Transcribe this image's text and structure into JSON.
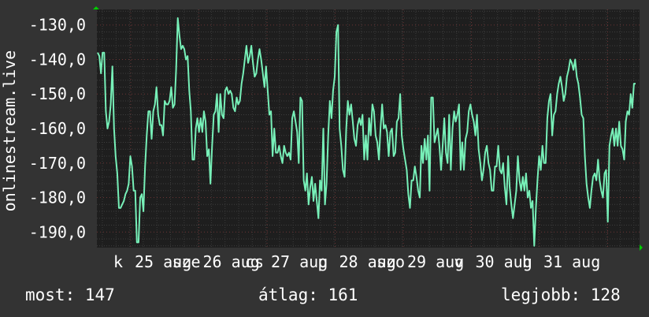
{
  "chart_data": {
    "type": "line",
    "ylabel": "onlinestream.live",
    "ylim": [
      -194.5,
      -125.5
    ],
    "yticks": [
      "-130,0",
      "-140,0",
      "-150,0",
      "-160,0",
      "-170,0",
      "-180,0",
      "-190,0"
    ],
    "ytick_values": [
      -130,
      -140,
      -150,
      -160,
      -170,
      -180,
      -190
    ],
    "xticks": [
      "k",
      "25 aug",
      "sze",
      "26 aug",
      "cs",
      "27 aug",
      "p",
      "28 aug",
      "szo",
      "29 aug",
      "v",
      "30 aug",
      "h",
      "31 aug"
    ],
    "grid": true,
    "series_color": "#77f0b8",
    "background": "#1e1e1e",
    "series": [
      {
        "values": [
          -138,
          -139,
          -144,
          -138,
          -138,
          -155,
          -160,
          -158,
          -153,
          -142,
          -160,
          -168,
          -173,
          -183,
          -183,
          -182,
          -181,
          -179,
          -178,
          -176,
          -168,
          -171,
          -178,
          -178,
          -193,
          -193,
          -180,
          -179,
          -184,
          -171,
          -162,
          -155,
          -155,
          -163,
          -155,
          -153,
          -148,
          -156,
          -159,
          -159,
          -162,
          -152,
          -153,
          -153,
          -152,
          -148,
          -154,
          -153,
          -143,
          -128,
          -133,
          -137,
          -136,
          -137,
          -140,
          -139,
          -149,
          -155,
          -169,
          -169,
          -160,
          -157,
          -161,
          -157,
          -161,
          -155,
          -158,
          -168,
          -166,
          -176,
          -165,
          -156,
          -155,
          -150,
          -161,
          -150,
          -156,
          -157,
          -149,
          -148,
          -150,
          -149,
          -150,
          -154,
          -155,
          -151,
          -153,
          -152,
          -147,
          -144,
          -140,
          -136,
          -141,
          -139,
          -136,
          -141,
          -145,
          -144,
          -140,
          -137,
          -140,
          -144,
          -148,
          -142,
          -149,
          -156,
          -155,
          -168,
          -160,
          -167,
          -167,
          -165,
          -168,
          -170,
          -165,
          -167,
          -168,
          -167,
          -169,
          -157,
          -155,
          -158,
          -161,
          -170,
          -151,
          -152,
          -175,
          -178,
          -173,
          -182,
          -177,
          -174,
          -181,
          -176,
          -181,
          -186,
          -175,
          -178,
          -160,
          -182,
          -176,
          -162,
          -152,
          -157,
          -149,
          -145,
          -132,
          -130,
          -160,
          -165,
          -172,
          -174,
          -160,
          -152,
          -156,
          -153,
          -158,
          -163,
          -165,
          -159,
          -157,
          -159,
          -156,
          -169,
          -162,
          -169,
          -157,
          -162,
          -153,
          -155,
          -162,
          -164,
          -169,
          -160,
          -153,
          -160,
          -159,
          -161,
          -168,
          -161,
          -160,
          -168,
          -167,
          -158,
          -157,
          -150,
          -162,
          -166,
          -169,
          -172,
          -179,
          -183,
          -175,
          -175,
          -171,
          -174,
          -178,
          -180,
          -165,
          -170,
          -163,
          -169,
          -162,
          -178,
          -151,
          -151,
          -164,
          -162,
          -160,
          -165,
          -172,
          -165,
          -157,
          -167,
          -170,
          -156,
          -172,
          -160,
          -155,
          -158,
          -156,
          -153,
          -172,
          -164,
          -172,
          -163,
          -161,
          -155,
          -153,
          -156,
          -158,
          -162,
          -156,
          -166,
          -170,
          -175,
          -172,
          -167,
          -165,
          -170,
          -172,
          -178,
          -178,
          -171,
          -171,
          -165,
          -172,
          -173,
          -170,
          -177,
          -182,
          -168,
          -177,
          -182,
          -186,
          -182,
          -178,
          -168,
          -175,
          -178,
          -174,
          -178,
          -173,
          -180,
          -178,
          -183,
          -181,
          -194,
          -183,
          -175,
          -168,
          -172,
          -165,
          -170,
          -170,
          -157,
          -152,
          -150,
          -162,
          -156,
          -155,
          -150,
          -147,
          -145,
          -148,
          -152,
          -150,
          -145,
          -143,
          -140,
          -141,
          -143,
          -140,
          -145,
          -147,
          -151,
          -156,
          -157,
          -168,
          -176,
          -180,
          -183,
          -178,
          -174,
          -173,
          -175,
          -169,
          -175,
          -178,
          -180,
          -173,
          -172,
          -187,
          -165,
          -162,
          -160,
          -165,
          -160,
          -165,
          -158,
          -165,
          -166,
          -169,
          -158,
          -155,
          -156,
          -150,
          -154,
          -147,
          -147
        ]
      }
    ]
  },
  "stats": {
    "now": "most: 147",
    "average": "átlag: 161",
    "best": "legjobb: 128"
  }
}
